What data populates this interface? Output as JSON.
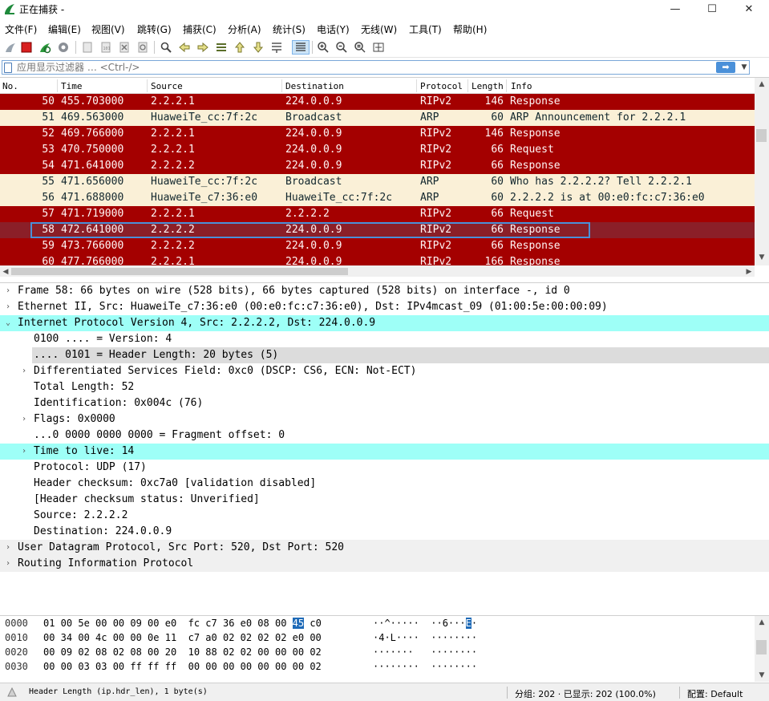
{
  "window": {
    "title": "正在捕获 -",
    "minimize": "—",
    "maximize": "☐",
    "close": "✕"
  },
  "menu": [
    "文件(F)",
    "编辑(E)",
    "视图(V)",
    "跳转(G)",
    "捕获(C)",
    "分析(A)",
    "统计(S)",
    "电话(Y)",
    "无线(W)",
    "工具(T)",
    "帮助(H)"
  ],
  "toolbar": {
    "icons": [
      "shark-fin-start-icon",
      "stop-icon",
      "restart-icon",
      "options-gear-icon",
      "open-file-icon",
      "save-file-icon",
      "close-file-icon",
      "reload-icon",
      "find-icon",
      "go-back-icon",
      "go-forward-icon",
      "go-to-packet-icon",
      "first-packet-icon",
      "last-packet-icon",
      "autoscroll-icon",
      "colorize-icon",
      "zoom-in-icon",
      "zoom-out-icon",
      "zoom-normal-icon",
      "resize-columns-icon"
    ]
  },
  "filter": {
    "placeholder": "应用显示过滤器 … <Ctrl-/>",
    "apply_icon": "arrow-right-icon",
    "dropdown_icon": "chevron-down-icon"
  },
  "packet_list": {
    "columns": [
      "No.",
      "Time",
      "Source",
      "Destination",
      "Protocol",
      "Length",
      "Info"
    ],
    "rows": [
      {
        "no": "50",
        "time": "455.703000",
        "src": "2.2.2.1",
        "dst": "224.0.0.9",
        "proto": "RIPv2",
        "len": "146",
        "info": "Response",
        "style": "red"
      },
      {
        "no": "51",
        "time": "469.563000",
        "src": "HuaweiTe_cc:7f:2c",
        "dst": "Broadcast",
        "proto": "ARP",
        "len": "60",
        "info": "ARP Announcement for 2.2.2.1",
        "style": "tan"
      },
      {
        "no": "52",
        "time": "469.766000",
        "src": "2.2.2.1",
        "dst": "224.0.0.9",
        "proto": "RIPv2",
        "len": "146",
        "info": "Response",
        "style": "red"
      },
      {
        "no": "53",
        "time": "470.750000",
        "src": "2.2.2.1",
        "dst": "224.0.0.9",
        "proto": "RIPv2",
        "len": "66",
        "info": "Request",
        "style": "red"
      },
      {
        "no": "54",
        "time": "471.641000",
        "src": "2.2.2.2",
        "dst": "224.0.0.9",
        "proto": "RIPv2",
        "len": "66",
        "info": "Response",
        "style": "red"
      },
      {
        "no": "55",
        "time": "471.656000",
        "src": "HuaweiTe_cc:7f:2c",
        "dst": "Broadcast",
        "proto": "ARP",
        "len": "60",
        "info": "Who has 2.2.2.2? Tell 2.2.2.1",
        "style": "tan"
      },
      {
        "no": "56",
        "time": "471.688000",
        "src": "HuaweiTe_c7:36:e0",
        "dst": "HuaweiTe_cc:7f:2c",
        "proto": "ARP",
        "len": "60",
        "info": "2.2.2.2 is at 00:e0:fc:c7:36:e0",
        "style": "tan"
      },
      {
        "no": "57",
        "time": "471.719000",
        "src": "2.2.2.1",
        "dst": "2.2.2.2",
        "proto": "RIPv2",
        "len": "66",
        "info": "Request",
        "style": "red"
      },
      {
        "no": "58",
        "time": "472.641000",
        "src": "2.2.2.2",
        "dst": "224.0.0.9",
        "proto": "RIPv2",
        "len": "66",
        "info": "Response",
        "style": "sel"
      },
      {
        "no": "59",
        "time": "473.766000",
        "src": "2.2.2.2",
        "dst": "224.0.0.9",
        "proto": "RIPv2",
        "len": "66",
        "info": "Response",
        "style": "red"
      },
      {
        "no": "60",
        "time": "477.766000",
        "src": "2.2.2.1",
        "dst": "224.0.0.9",
        "proto": "RIPv2",
        "len": "166",
        "info": "Response",
        "style": "red"
      }
    ]
  },
  "details": [
    {
      "text": "Frame 58: 66 bytes on wire (528 bits), 66 bytes captured (528 bits) on interface -, id 0",
      "indent": 0,
      "arrow": "›",
      "style": ""
    },
    {
      "text": "Ethernet II, Src: HuaweiTe_c7:36:e0 (00:e0:fc:c7:36:e0), Dst: IPv4mcast_09 (01:00:5e:00:00:09)",
      "indent": 0,
      "arrow": "›",
      "style": ""
    },
    {
      "text": "Internet Protocol Version 4, Src: 2.2.2.2, Dst: 224.0.0.9",
      "indent": 0,
      "arrow": "⌄",
      "style": "hl"
    },
    {
      "text": "0100 .... = Version: 4",
      "indent": 1,
      "arrow": "",
      "style": ""
    },
    {
      "text": ".... 0101 = Header Length: 20 bytes (5)",
      "indent": 1,
      "arrow": "",
      "style": "sub-hl"
    },
    {
      "text": "Differentiated Services Field: 0xc0 (DSCP: CS6, ECN: Not-ECT)",
      "indent": 1,
      "arrow": "›",
      "style": ""
    },
    {
      "text": "Total Length: 52",
      "indent": 1,
      "arrow": "",
      "style": ""
    },
    {
      "text": "Identification: 0x004c (76)",
      "indent": 1,
      "arrow": "",
      "style": ""
    },
    {
      "text": "Flags: 0x0000",
      "indent": 1,
      "arrow": "›",
      "style": ""
    },
    {
      "text": "...0 0000 0000 0000 = Fragment offset: 0",
      "indent": 1,
      "arrow": "",
      "style": ""
    },
    {
      "text": "Time to live: 14",
      "indent": 1,
      "arrow": "›",
      "style": "hl"
    },
    {
      "text": "Protocol: UDP (17)",
      "indent": 1,
      "arrow": "",
      "style": ""
    },
    {
      "text": "Header checksum: 0xc7a0 [validation disabled]",
      "indent": 1,
      "arrow": "",
      "style": ""
    },
    {
      "text": "[Header checksum status: Unverified]",
      "indent": 1,
      "arrow": "",
      "style": ""
    },
    {
      "text": "Source: 2.2.2.2",
      "indent": 1,
      "arrow": "",
      "style": ""
    },
    {
      "text": "Destination: 224.0.0.9",
      "indent": 1,
      "arrow": "",
      "style": ""
    },
    {
      "text": "User Datagram Protocol, Src Port: 520, Dst Port: 520",
      "indent": 0,
      "arrow": "›",
      "style": "gray"
    },
    {
      "text": "Routing Information Protocol",
      "indent": 0,
      "arrow": "›",
      "style": "gray"
    }
  ],
  "bytes": [
    {
      "offset": "0000",
      "hex_a": "01 00 5e 00 00 09 00 e0  fc c7 36 e0 08 00 ",
      "hex_hl": "45",
      "hex_b": " c0",
      "ascii_a": "··^·····  ··6···",
      "ascii_hl": "E",
      "ascii_b": "·"
    },
    {
      "offset": "0010",
      "hex_a": "00 34 00 4c 00 00 0e 11  c7 a0 02 02 02 02 e0 00",
      "hex_hl": "",
      "hex_b": "",
      "ascii_a": "·4·L····  ········",
      "ascii_hl": "",
      "ascii_b": ""
    },
    {
      "offset": "0020",
      "hex_a": "00 09 02 08 02 08 00 20  10 88 02 02 00 00 00 02",
      "hex_hl": "",
      "hex_b": "",
      "ascii_a": "·······   ········",
      "ascii_hl": "",
      "ascii_b": ""
    },
    {
      "offset": "0030",
      "hex_a": "00 00 03 03 00 ff ff ff  00 00 00 00 00 00 00 02",
      "hex_hl": "",
      "hex_b": "",
      "ascii_a": "········  ········",
      "ascii_hl": "",
      "ascii_b": ""
    }
  ],
  "status": {
    "field": "Header Length (ip.hdr_len), 1 byte(s)",
    "packets": "分组: 202 · 已显示: 202 (100.0%)",
    "profile": "配置: Default"
  },
  "colors": {
    "red_row": "#a40000",
    "tan_row": "#faf0d7",
    "selected_row": "#8b1f28",
    "highlight": "#9efff7",
    "accent": "#4a90d9"
  }
}
